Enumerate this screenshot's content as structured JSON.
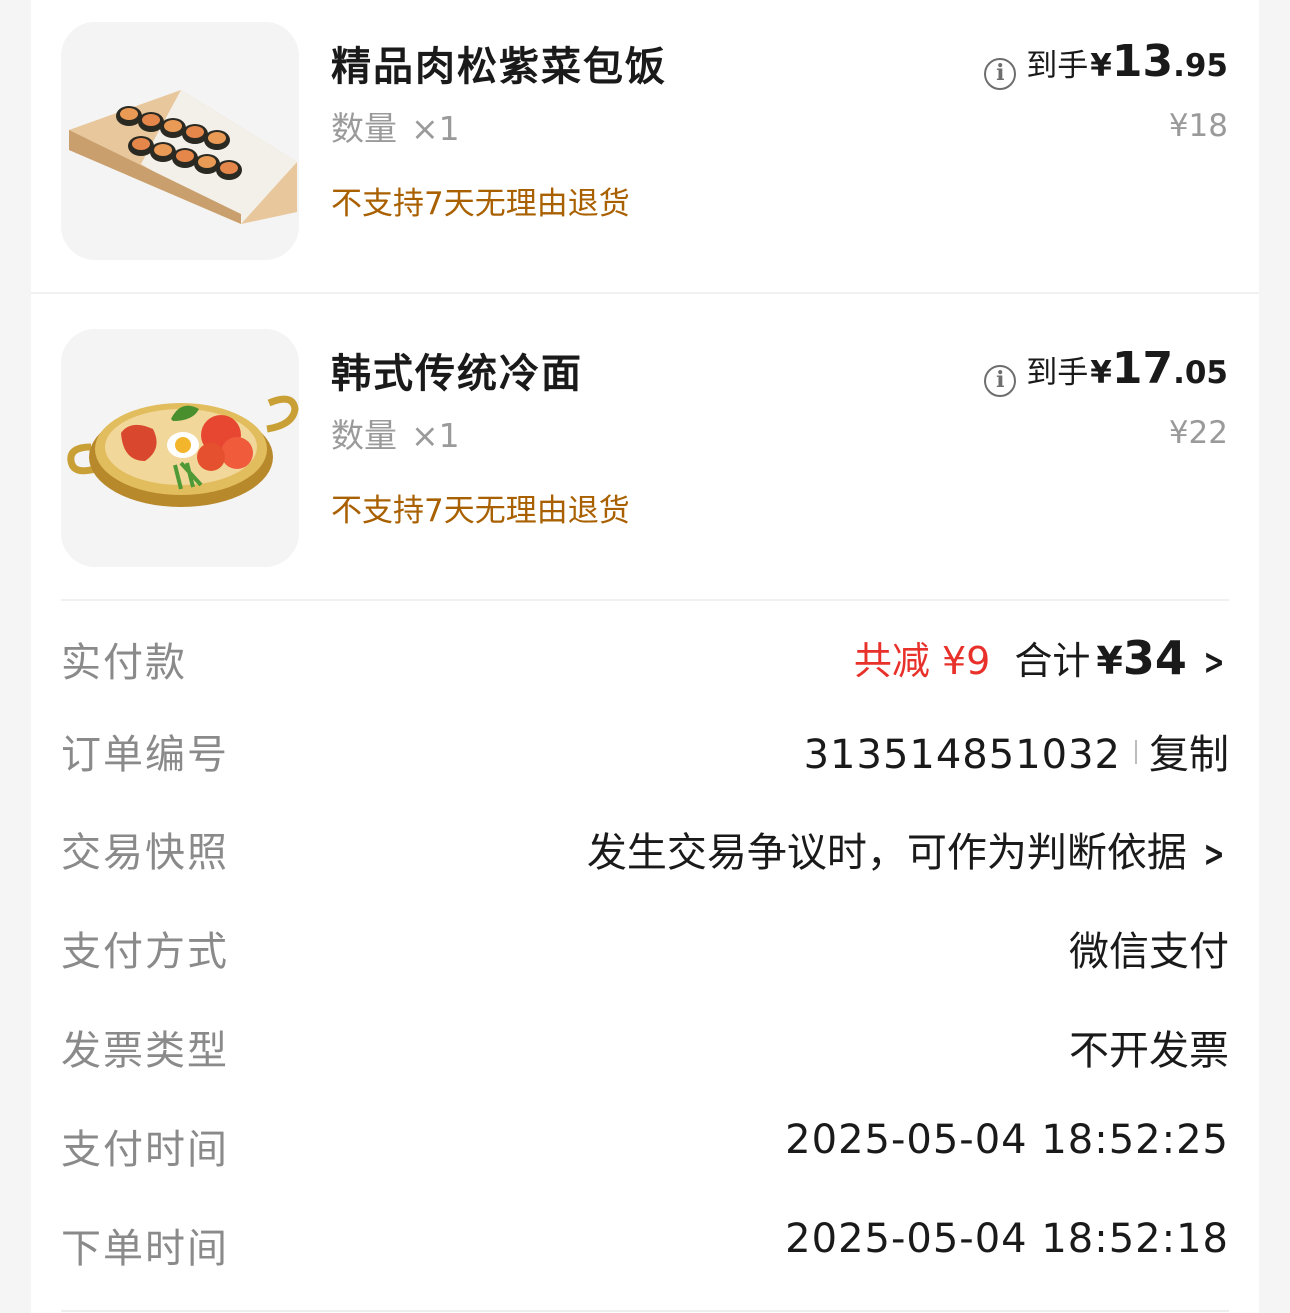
{
  "products": [
    {
      "title": "精品肉松紫菜包饭",
      "qty_label": "数量",
      "qty_value": "×1",
      "policy": "不支持7天无理由退货",
      "pay_label": "到手",
      "pay_yen": "¥",
      "pay_int": "13",
      "pay_dec": ".95",
      "original_price": "¥18",
      "thumbnail": "kimbap-rolls-image"
    },
    {
      "title": "韩式传统冷面",
      "qty_label": "数量",
      "qty_value": "×1",
      "policy": "不支持7天无理由退货",
      "pay_label": "到手",
      "pay_yen": "¥",
      "pay_int": "17",
      "pay_dec": ".05",
      "original_price": "¥22",
      "thumbnail": "cold-noodles-image"
    }
  ],
  "summary": {
    "paid_label": "实付款",
    "discount": "共减 ¥9",
    "total_label": "合计",
    "total_yen": "¥",
    "total_value": "34",
    "order_no_label": "订单编号",
    "order_no": "313514851032",
    "copy_label": "复制",
    "snapshot_label": "交易快照",
    "snapshot_value": "发生交易争议时，可作为判断依据",
    "pay_method_label": "支付方式",
    "pay_method": "微信支付",
    "invoice_label": "发票类型",
    "invoice": "不开发票",
    "pay_time_label": "支付时间",
    "pay_time": "2025-05-04 18:52:25",
    "order_time_label": "下单时间",
    "order_time": "2025-05-04 18:52:18"
  },
  "colors": {
    "discount": "#e8312a",
    "policy": "#a96000",
    "muted": "#9a9a9a"
  },
  "icons": [
    "info-icon",
    "chevron-right-icon"
  ]
}
